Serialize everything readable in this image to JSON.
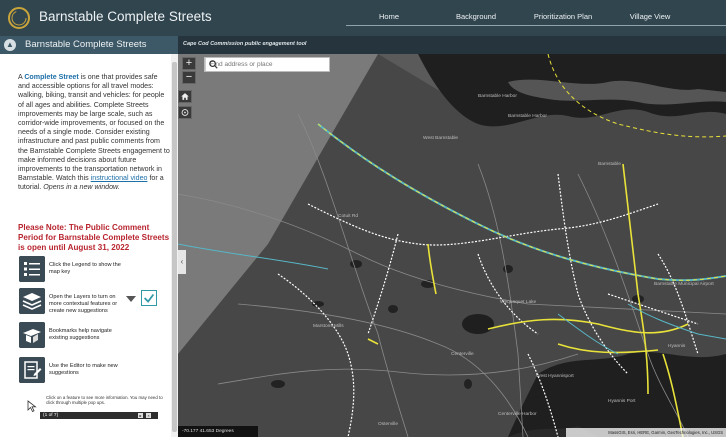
{
  "header": {
    "title": "Barnstable Complete Streets",
    "nav": [
      {
        "label": "Home"
      },
      {
        "label": "Background"
      },
      {
        "label": "Prioritization Plan"
      },
      {
        "label": "Village View"
      }
    ]
  },
  "subheader": {
    "panel_title": "Barnstable Complete Streets",
    "tagline": "Cape Cod Commission public engagement tool"
  },
  "panel": {
    "intro_pre": "A ",
    "intro_term": "Complete Street",
    "intro_body": " is one that provides safe and accessible options for all travel modes: walking, biking, transit and vehicles:  for people of all ages and abilities. Complete Streets improvements may be large scale, such as corridor-wide improvements, or focused on the needs of a single mode. Consider existing infrastructure and past public comments from the Barnstable Complete Streets engagement to make informed decisions about future improvements to the transportation network in Barnstable.  Watch this ",
    "intro_link": "instructional video",
    "intro_post": " for a tutorial. ",
    "intro_italic": "Opens in a new window.",
    "note": "Please Note: The Public Comment Period for Barnstable Complete Streets is open until August 31, 2022",
    "steps": [
      {
        "text": "Click the Legend to show the map key"
      },
      {
        "text": "Open the Layers to turn on more contextual features or create new suggestions"
      },
      {
        "text": "Bookmarks help navigate existing suggestions"
      },
      {
        "text": "Use the Editor to make new suggestions"
      }
    ],
    "click_note": "Click on a feature to see more information. You may need to click through multiple pop ups.",
    "popup_count": "(1 of 7)"
  },
  "map": {
    "search_placeholder": "Find address or place",
    "zoom_in": "+",
    "zoom_out": "−",
    "collapse": "‹",
    "coordinates": "-70.177 41.653 Degrees",
    "attribution": "MassGIS, Esri, HERE, Garmin, GeoTechnologies, Inc., USGS",
    "labels": [
      {
        "text": "Barnstable Harbor"
      },
      {
        "text": "Barnstable Harbor"
      },
      {
        "text": "West Barnstable"
      },
      {
        "text": "Barnstable"
      },
      {
        "text": "Cotuit Rd"
      },
      {
        "text": "Wequaquet Lake"
      },
      {
        "text": "Barnstable Municipal Airport"
      },
      {
        "text": "Marstons Mills"
      },
      {
        "text": "Centerville"
      },
      {
        "text": "West Hyannisport"
      },
      {
        "text": "Hyannis"
      },
      {
        "text": "Hyannis Port"
      },
      {
        "text": "Osterville"
      },
      {
        "text": "Centerville Harbor"
      }
    ]
  },
  "colors": {
    "header_bg": "#31454f",
    "accent_gold": "#c9a43b",
    "note_red": "#b8252f",
    "link_blue": "#1d6fa8",
    "road_yellow": "#e8e23a",
    "road_teal": "#58b7c7",
    "trail_white": "#ffffff"
  },
  "icons": [
    "logo-ring-icon",
    "legend-icon",
    "layers-icon",
    "bookmarks-icon",
    "editor-icon",
    "chevron-down-icon",
    "check-icon",
    "search-icon",
    "home-icon",
    "locate-icon",
    "cursor-icon"
  ]
}
